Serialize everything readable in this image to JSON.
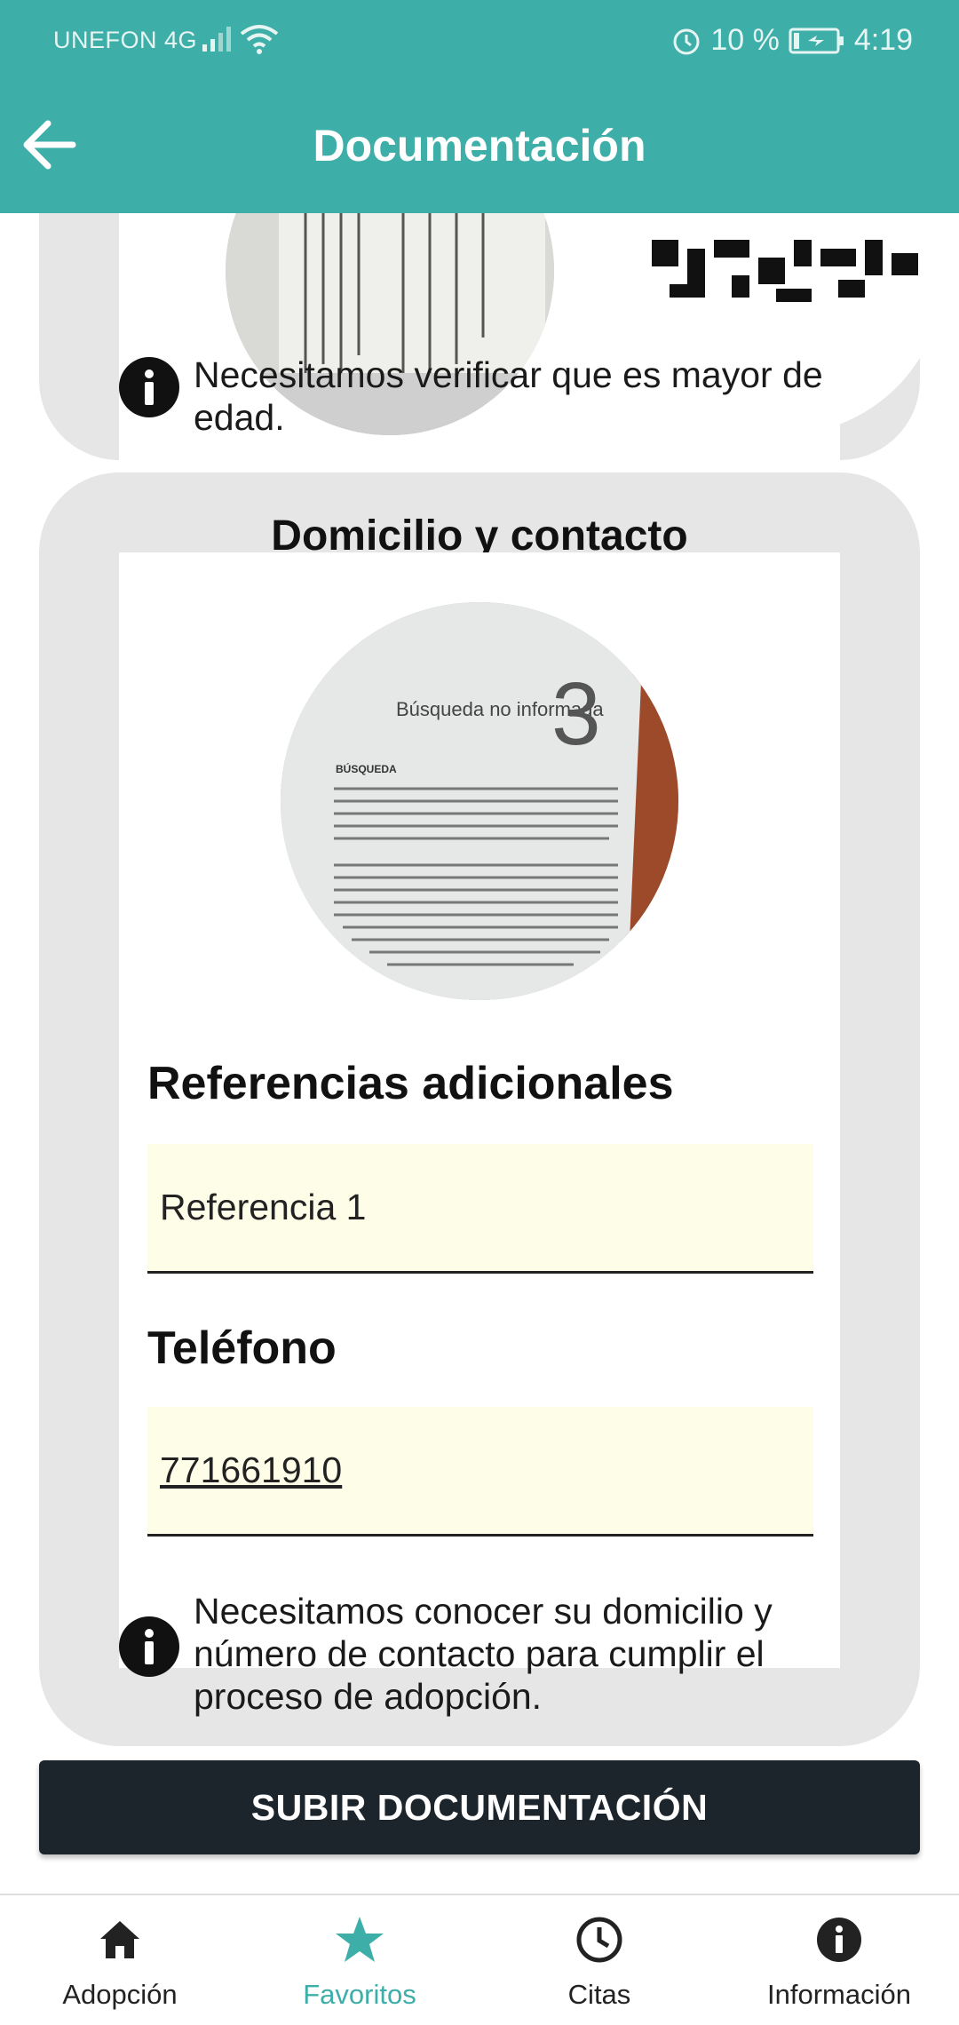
{
  "status_bar": {
    "carrier": "UNEFON 4G",
    "battery": "10 %",
    "time": "4:19"
  },
  "header": {
    "title": "Documentación"
  },
  "identification_card": {
    "info_text": "Necesitamos verificar que es mayor de edad."
  },
  "address_card": {
    "title": "Domicilio y contacto",
    "references_label": "Referencias adicionales",
    "references_value": "Referencia 1",
    "phone_label": "Teléfono",
    "phone_value": "771661910",
    "info_text": "Necesitamos conocer su domicilio y número de contacto para cumplir el proceso de adopción."
  },
  "actions": {
    "submit_label": "SUBIR DOCUMENTACIÓN"
  },
  "bottom_nav": {
    "items": [
      {
        "label": "Adopción",
        "icon": "home-icon"
      },
      {
        "label": "Favoritos",
        "icon": "star-icon",
        "active": true
      },
      {
        "label": "Citas",
        "icon": "clock-icon"
      },
      {
        "label": "Información",
        "icon": "info-icon"
      }
    ]
  },
  "colors": {
    "accent": "#3daea8",
    "card_bg": "#e6e6e6",
    "field_bg": "#fefee8",
    "button_bg": "#1c252b"
  }
}
